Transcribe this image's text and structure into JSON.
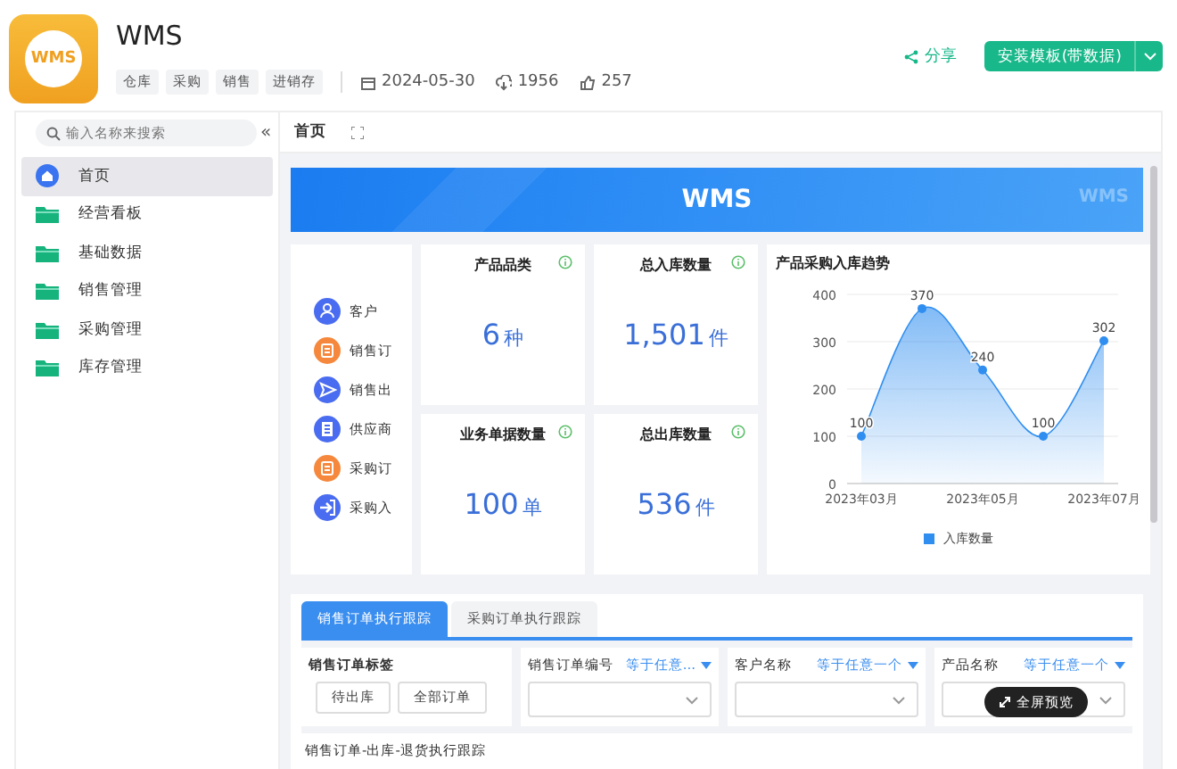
{
  "app": {
    "logo_text": "WMS",
    "title": "WMS",
    "tags": [
      "仓库",
      "采购",
      "销售",
      "进销存"
    ],
    "date": "2024-05-30",
    "downloads": "1956",
    "likes": "257",
    "share": "分享",
    "install": "安装模板(带数据)"
  },
  "sidebar": {
    "search_placeholder": "输入名称来搜索",
    "collapse": "«",
    "items": [
      {
        "label": "首页",
        "kind": "home",
        "selected": true
      },
      {
        "label": "经营看板",
        "kind": "folder",
        "selected": false
      },
      {
        "label": "基础数据",
        "kind": "folder",
        "selected": false
      },
      {
        "label": "销售管理",
        "kind": "folder",
        "selected": false
      },
      {
        "label": "采购管理",
        "kind": "folder",
        "selected": false
      },
      {
        "label": "库存管理",
        "kind": "folder",
        "selected": false
      }
    ]
  },
  "page_tab": "首页",
  "banner": {
    "title": "WMS",
    "watermark": "WMS"
  },
  "quick_links": [
    {
      "label": "客户",
      "kind": "person",
      "color": "#4a6cf0"
    },
    {
      "label": "销售订",
      "kind": "doc",
      "color": "#f5883c"
    },
    {
      "label": "销售出",
      "kind": "send",
      "color": "#4a6cf0"
    },
    {
      "label": "供应商",
      "kind": "building",
      "color": "#4a6cf0"
    },
    {
      "label": "采购订",
      "kind": "doc",
      "color": "#f5883c"
    },
    {
      "label": "采购入",
      "kind": "enter",
      "color": "#4a6cf0"
    }
  ],
  "stats": [
    {
      "title": "产品品类",
      "value": "6",
      "unit": "种"
    },
    {
      "title": "总入库数量",
      "value": "1,501",
      "unit": "件"
    },
    {
      "title": "业务单据数量",
      "value": "100",
      "unit": "单"
    },
    {
      "title": "总出库数量",
      "value": "536",
      "unit": "件"
    }
  ],
  "chart": {
    "title": "产品采购入库趋势",
    "chart_data": {
      "type": "area",
      "categories": [
        "2023年03月",
        null,
        "2023年05月",
        null,
        "2023年07月"
      ],
      "yticks": [
        0,
        100,
        200,
        300,
        400
      ],
      "ylim": [
        0,
        400
      ],
      "grid": true,
      "data_labels": true,
      "series": [
        {
          "name": "入库数量",
          "color": "#2f8ef0",
          "values": [
            100,
            370,
            240,
            100,
            302
          ]
        }
      ]
    }
  },
  "tabs": [
    {
      "label": "销售订单执行跟踪",
      "selected": true
    },
    {
      "label": "采购订单执行跟踪",
      "selected": false
    }
  ],
  "filters": {
    "tag_label": "销售订单标签",
    "tag_buttons": [
      "待出库",
      "全部订单"
    ],
    "fields": [
      {
        "label": "销售订单编号",
        "operator": "等于任意..."
      },
      {
        "label": "客户名称",
        "operator": "等于任意一个"
      },
      {
        "label": "产品名称",
        "operator": "等于任意一个"
      }
    ]
  },
  "section_title": "销售订单-出库-退货执行跟踪",
  "fullscreen_button": "全屏预览"
}
